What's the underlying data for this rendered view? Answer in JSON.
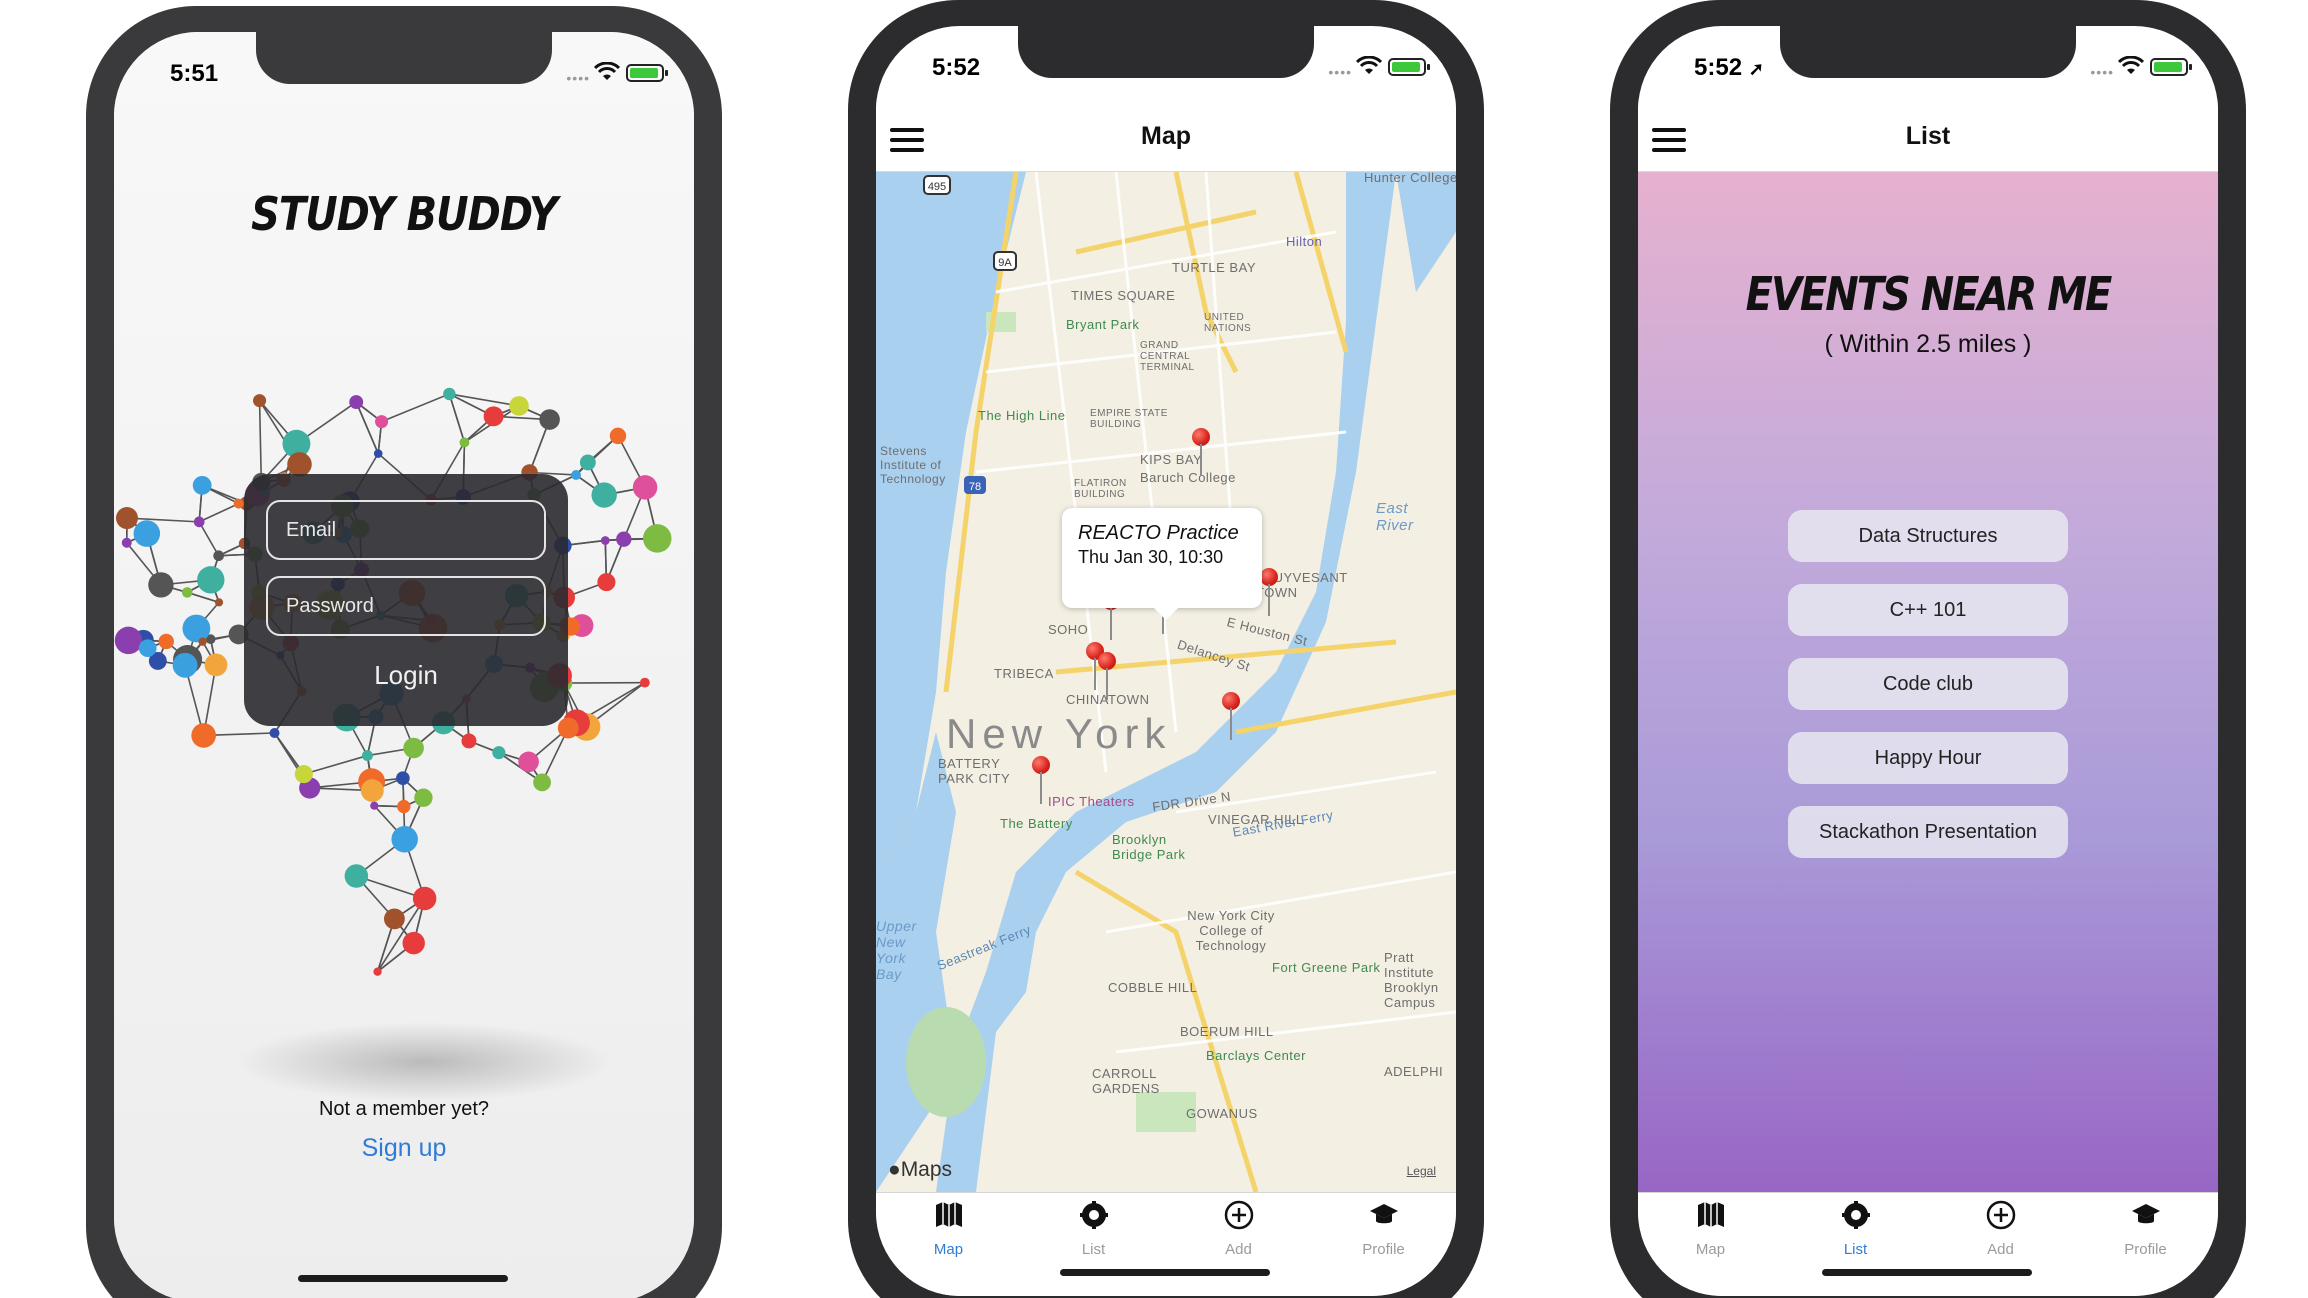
{
  "phones": [
    {
      "status_time": "5:51",
      "app_logo": "STUDY BUDDY",
      "email_placeholder": "Email",
      "password_placeholder": "Password",
      "login_label": "Login",
      "not_member_text": "Not a member yet?",
      "signup_label": "Sign up"
    },
    {
      "status_time": "5:52",
      "nav_title": "Map",
      "callout_title": "REACTO Practice",
      "callout_subtitle": "Thu Jan 30, 10:30",
      "map_labels": {
        "city": "New York",
        "times_square": "TIMES SQUARE",
        "bryant_park": "Bryant Park",
        "grand_central": "GRAND CENTRAL TERMINAL",
        "turtle_bay": "TURTLE BAY",
        "united_nations": "UNITED NATIONS",
        "high_line": "The High Line",
        "empire_state": "EMPIRE STATE BUILDING",
        "kips_bay": "KIPS BAY",
        "baruch": "Baruch College",
        "flatiron": "FLATIRON BUILDING",
        "stevens": "Stevens Institute of Technology",
        "east_river": "East River",
        "stuyvesant": "STUYVESANT TOWN",
        "soho": "SOHO",
        "tribeca": "TRIBECA",
        "chinatown": "CHINATOWN",
        "delancey": "Delancey St",
        "houston": "E Houston St",
        "battery_park_city": "BATTERY PARK CITY",
        "ipic": "IPIC Theaters",
        "the_battery": "The Battery",
        "vinegar_hill": "VINEGAR HILL",
        "brooklyn_bridge_park": "Brooklyn Bridge Park",
        "nyc_tech": "New York City College of Technology",
        "fort_greene": "Fort Greene Park",
        "pratt": "Pratt Institute Brooklyn Campus",
        "cobble_hill": "COBBLE HILL",
        "boerum_hill": "BOERUM HILL",
        "barclays": "Barclays Center",
        "carroll_gardens": "CARROLL GARDENS",
        "gowanus": "GOWANUS",
        "hilton": "Hilton",
        "hunter": "Hunter College",
        "fdr": "FDR Drive N",
        "east_river_ferry": "East River Ferry",
        "seastreak": "Seastreak Ferry",
        "upper_bay": "Upper New York Bay",
        "route_495": "495",
        "route_9a": "9A",
        "route_78": "78",
        "adelphi": "ADELPHI"
      },
      "maps_brand": "Maps",
      "legal_label": "Legal"
    },
    {
      "status_time": "5:52",
      "nav_title": "List",
      "heading": "EVENTS NEAR ME",
      "subheading": "( Within 2.5 miles  )",
      "events": [
        "Data Structures",
        "C++ 101",
        "Code club",
        "Happy Hour",
        "Stackathon Presentation"
      ]
    }
  ],
  "tabs": [
    {
      "label": "Map",
      "icon": "map-icon"
    },
    {
      "label": "List",
      "icon": "list-icon"
    },
    {
      "label": "Add",
      "icon": "add-icon"
    },
    {
      "label": "Profile",
      "icon": "profile-icon"
    }
  ],
  "colors": {
    "accent": "#2f7bd8",
    "pin": "#d6221a",
    "list_gradient_top": "#e6b1cf",
    "list_gradient_bottom": "#9866c5"
  }
}
